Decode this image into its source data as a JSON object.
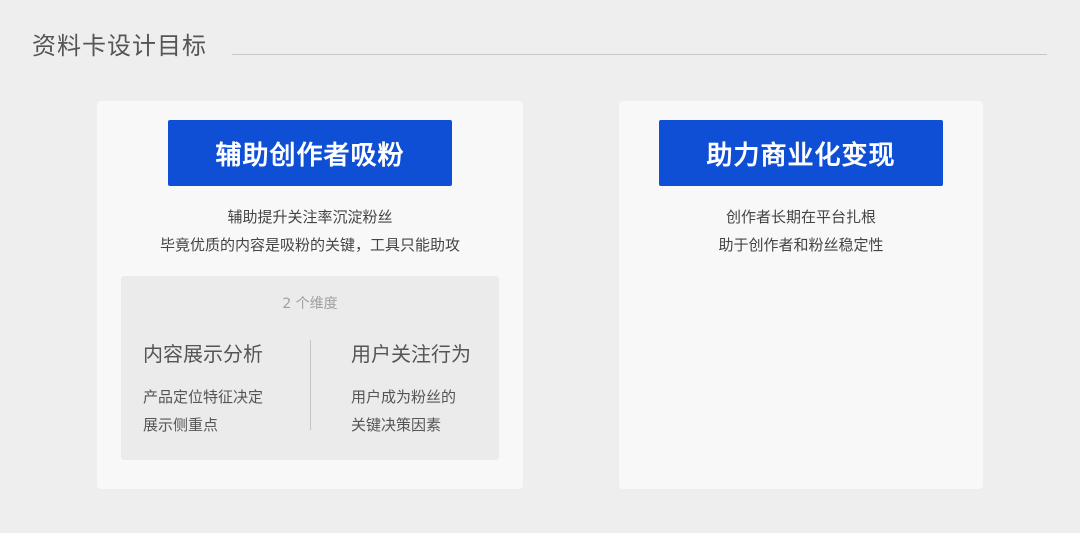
{
  "header": {
    "title": "资料卡设计目标"
  },
  "cards": [
    {
      "button_label": "辅助创作者吸粉",
      "desc": [
        "辅助提升关注率沉淀粉丝",
        "毕竟优质的内容是吸粉的关键，工具只能助攻"
      ],
      "dimensions": {
        "title": "2 个维度",
        "columns": [
          {
            "heading": "内容展示分析",
            "lines": [
              "产品定位特征决定",
              "展示侧重点"
            ]
          },
          {
            "heading": "用户关注行为",
            "lines": [
              "用户成为粉丝的",
              "关键决策因素"
            ]
          }
        ]
      }
    },
    {
      "button_label": "助力商业化变现",
      "desc": [
        "创作者长期在平台扎根",
        "助于创作者和粉丝稳定性"
      ]
    }
  ],
  "colors": {
    "accent": "#0e4fd6",
    "background": "#eeeeee",
    "card": "#f8f8f8"
  }
}
